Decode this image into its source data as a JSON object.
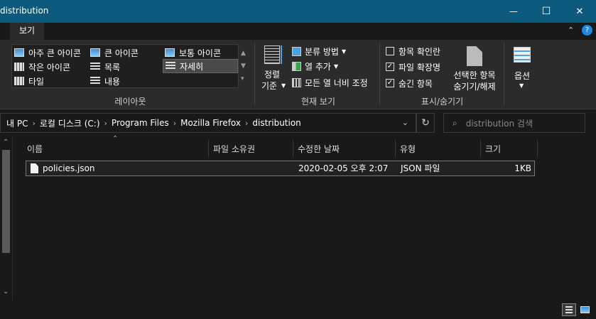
{
  "window": {
    "title": "distribution",
    "minimize_glyph": "—",
    "maximize_glyph": "☐",
    "close_glyph": "✕"
  },
  "ribbon": {
    "active_tab": "보기",
    "layout": {
      "group_label": "레이아웃",
      "items": [
        "아주 큰 아이콘",
        "큰 아이콘",
        "보통 아이콘",
        "작은 아이콘",
        "목록",
        "자세히",
        "타일",
        "내용"
      ],
      "selected": "자세히"
    },
    "current_view": {
      "group_label": "현재 보기",
      "sort_label_1": "정렬",
      "sort_label_2": "기준",
      "group_by": "분류 방법",
      "add_column": "열 추가",
      "fit_columns": "모든 열 너비 조정"
    },
    "show_hide": {
      "group_label": "표시/숨기기",
      "item_checkboxes": {
        "label": "항목 확인란",
        "checked": false
      },
      "file_extensions": {
        "label": "파일 확장명",
        "checked": true
      },
      "hidden_items": {
        "label": "숨긴 항목",
        "checked": true
      },
      "hide_selected_1": "선택한 항목",
      "hide_selected_2": "숨기기/해제"
    },
    "options_label": "옵션"
  },
  "address": {
    "crumbs": [
      "내 PC",
      "로컬 디스크 (C:)",
      "Program Files",
      "Mozilla Firefox",
      "distribution"
    ],
    "search_placeholder": "distribution 검색"
  },
  "columns": [
    "이름",
    "파일 소유권",
    "수정한 날짜",
    "유형",
    "크기"
  ],
  "files": [
    {
      "name": "policies.json",
      "owner": "",
      "modified": "2020-02-05 오후 2:07",
      "type": "JSON 파일",
      "size": "1KB"
    }
  ],
  "colors": {
    "titlebar": "#0c5a7e",
    "ribbon": "#2b2b2b",
    "background": "#191919"
  }
}
